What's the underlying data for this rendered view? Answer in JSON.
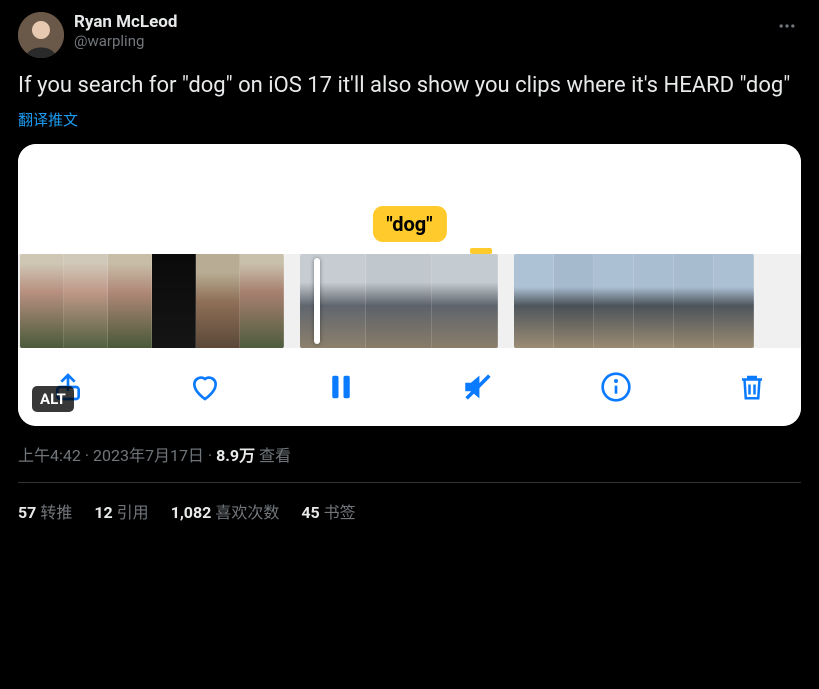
{
  "author": {
    "display_name": "Ryan McLeod",
    "handle": "@warpling"
  },
  "body": "If you search for \"dog\" on iOS 17 it'll also show you clips where it's HEARD \"dog\"",
  "translate_label": "翻译推文",
  "media": {
    "search_term": "\"dog\"",
    "alt_badge": "ALT"
  },
  "meta": {
    "time": "上午4:42",
    "sep1": " · ",
    "date": "2023年7月17日",
    "sep2": " · ",
    "views_count": "8.9万",
    "views_label": " 查看"
  },
  "stats": {
    "retweets_n": "57",
    "retweets_l": "转推",
    "quotes_n": "12",
    "quotes_l": "引用",
    "likes_n": "1,082",
    "likes_l": "喜欢次数",
    "bookmarks_n": "45",
    "bookmarks_l": "书签"
  }
}
